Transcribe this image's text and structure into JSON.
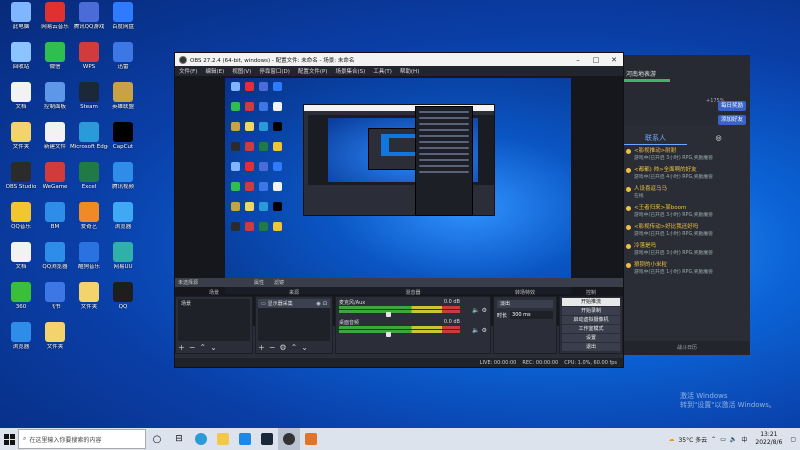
{
  "desktop_icons": [
    {
      "label": "此电脑",
      "color": "#7fb6ff"
    },
    {
      "label": "网易云音乐",
      "color": "#e03030"
    },
    {
      "label": "腾讯QQ游戏",
      "color": "#4b6cd8"
    },
    {
      "label": "百度网盘",
      "color": "#2f7bff"
    },
    {
      "label": "回收站",
      "color": "#8cc4ff"
    },
    {
      "label": "微信",
      "color": "#2fbf50"
    },
    {
      "label": "WPS",
      "color": "#d13b3b"
    },
    {
      "label": "迅雷",
      "color": "#3d77e6"
    },
    {
      "label": "文档",
      "color": "#f2f2f2"
    },
    {
      "label": "控制面板",
      "color": "#5f97e8"
    },
    {
      "label": "Steam",
      "color": "#1b2838"
    },
    {
      "label": "英雄联盟",
      "color": "#caa246"
    },
    {
      "label": "文件夹",
      "color": "#f3d36b"
    },
    {
      "label": "新建文件",
      "color": "#f2f2f2"
    },
    {
      "label": "Microsoft Edge",
      "color": "#2a9ad8"
    },
    {
      "label": "CapCut",
      "color": "#000000"
    },
    {
      "label": "OBS Studio",
      "color": "#2b2b2b"
    },
    {
      "label": "WeGame",
      "color": "#d23b3b"
    },
    {
      "label": "Excel",
      "color": "#1f7a45"
    },
    {
      "label": "腾讯视频",
      "color": "#2f8dea"
    },
    {
      "label": "QQ音乐",
      "color": "#f2c630"
    },
    {
      "label": "BM",
      "color": "#2f8dea"
    },
    {
      "label": "爱奇艺",
      "color": "#f08a24"
    },
    {
      "label": "浏览器",
      "color": "#3fa9f5"
    },
    {
      "label": "文档",
      "color": "#f2f2f2"
    },
    {
      "label": "QQ浏览器",
      "color": "#2f8dea"
    },
    {
      "label": "酷狗音乐",
      "color": "#2a72e0"
    },
    {
      "label": "网易UU",
      "color": "#2fb0a8"
    },
    {
      "label": "360",
      "color": "#3abf3a"
    },
    {
      "label": "飞书",
      "color": "#3d77e6"
    },
    {
      "label": "文件夹",
      "color": "#f3d36b"
    },
    {
      "label": "QQ",
      "color": "#1e1e1e"
    },
    {
      "label": "浏览器",
      "color": "#2f8dea"
    },
    {
      "label": "文件夹",
      "color": "#f3d36b"
    }
  ],
  "obs": {
    "title": "OBS 27.2.4 (64-bit, windows) - 配置文件: 未命名 - 场景: 未命名",
    "menu": [
      "文件(F)",
      "编辑(E)",
      "视图(V)",
      "停靠窗口(D)",
      "配置文件(P)",
      "场景集合(S)",
      "工具(T)",
      "帮助(H)"
    ],
    "selected_source": "未选择源",
    "properties": "属性",
    "filters": "滤镜",
    "headers": {
      "scenes": "场景",
      "sources": "来源",
      "mixer": "混音器",
      "transitions": "转场特效",
      "controls": "控制"
    },
    "scenes": [
      "场景"
    ],
    "sources": [
      "显示器采集"
    ],
    "mixer": [
      {
        "name": "麦克风/Aux",
        "level": "0.0 dB"
      },
      {
        "name": "桌面音频",
        "level": "0.0 dB"
      }
    ],
    "transition": "淡出",
    "duration_label": "时长",
    "duration_value": "300 ms",
    "controls": [
      "开始推流",
      "开始录制",
      "启动虚拟摄像机",
      "工作室模式",
      "设置",
      "退出"
    ],
    "status": [
      "LIVE: 00:00:00",
      "REC: 00:00:00",
      "CPU: 1.0%, 60.00 fps"
    ]
  },
  "chat": {
    "room_name": "河南地表游",
    "percent": "+175%",
    "btn_follow": "每日奖励",
    "btn_add": "添加好友",
    "tab_contacts": "联系人",
    "users": [
      {
        "name": "<影视推动>耐耐",
        "status": "游戏中(已开启 3小时) RPG,奖励魔兽"
      },
      {
        "name": "<都都) 帅>全面啊的好友",
        "status": "游戏中(已开启 4小时) RPG,奖励魔兽"
      },
      {
        "name": "人设喜返马马",
        "status": "在线"
      },
      {
        "name": "<王者归来>某boom",
        "status": "游戏中(已开启 3小时) RPG,奖励魔兽"
      },
      {
        "name": "<影视传动>好比我还好吗",
        "status": "游戏中(已开启 1小时) RPG,奖励魔兽"
      },
      {
        "name": "冷落是吗",
        "status": "游戏中(已开启 3小时) RPG,奖励魔兽"
      },
      {
        "name": "狼狈的小米粒",
        "status": "游戏中(已开启 1小时) RPG,奖励魔兽"
      }
    ],
    "footer": "战斗日历"
  },
  "watermark": [
    "激活 Windows",
    "转到\"设置\"以激活 Windows。"
  ],
  "taskbar": {
    "search_placeholder": "在这里输入你要搜索的内容",
    "weather": "35°C 多云",
    "time": "13:21",
    "date": "2022/8/6"
  }
}
